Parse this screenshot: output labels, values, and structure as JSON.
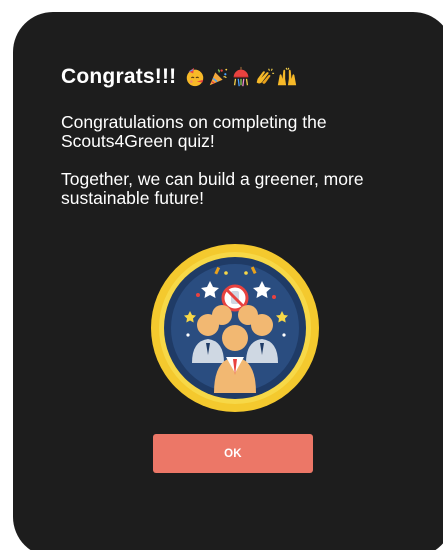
{
  "dialog": {
    "title": "Congrats!!!",
    "title_emojis": [
      "face-with-party-horn-icon",
      "party-popper-icon",
      "confetti-ball-icon",
      "clapping-hands-icon",
      "raising-hands-icon"
    ],
    "message_1": "Congratulations on completing the Scouts4Green quiz!",
    "message_2": "Together, we can build a greener, more sustainable future!",
    "ok_label": "OK"
  },
  "colors": {
    "dialog_bg": "#1d1d1d",
    "button": "#ec7767",
    "badge_ring": "#f4c92e",
    "badge_inner": "#1f3b66"
  }
}
